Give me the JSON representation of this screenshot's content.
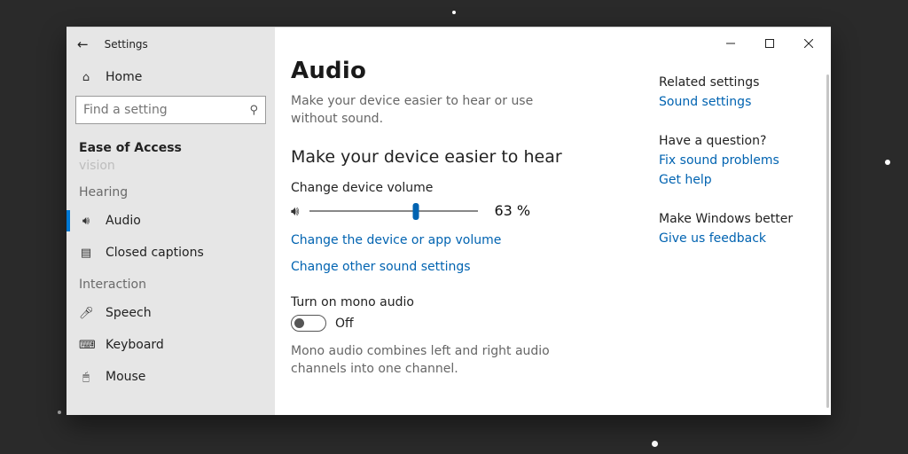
{
  "window": {
    "title": "Settings"
  },
  "sidebar": {
    "home": "Home",
    "search_placeholder": "Find a setting",
    "category": "Ease of Access",
    "partial_top": "vision",
    "groups": {
      "hearing": "Hearing",
      "interaction": "Interaction"
    },
    "items": {
      "audio": "Audio",
      "closed_captions": "Closed captions",
      "speech": "Speech",
      "keyboard": "Keyboard",
      "mouse": "Mouse"
    }
  },
  "main": {
    "title": "Audio",
    "subtitle": "Make your device easier to hear or use without sound.",
    "section_hear": "Make your device easier to hear",
    "vol_label": "Change device volume",
    "vol_value": 63,
    "vol_text": "63 %",
    "link_device_app": "Change the device or app volume",
    "link_other": "Change other sound settings",
    "mono_label": "Turn on mono audio",
    "mono_state": "Off",
    "mono_desc": "Mono audio combines left and right audio channels into one channel."
  },
  "right": {
    "related": "Related settings",
    "sound_settings": "Sound settings",
    "question": "Have a question?",
    "fix": "Fix sound problems",
    "get_help": "Get help",
    "better": "Make Windows better",
    "feedback": "Give us feedback"
  }
}
